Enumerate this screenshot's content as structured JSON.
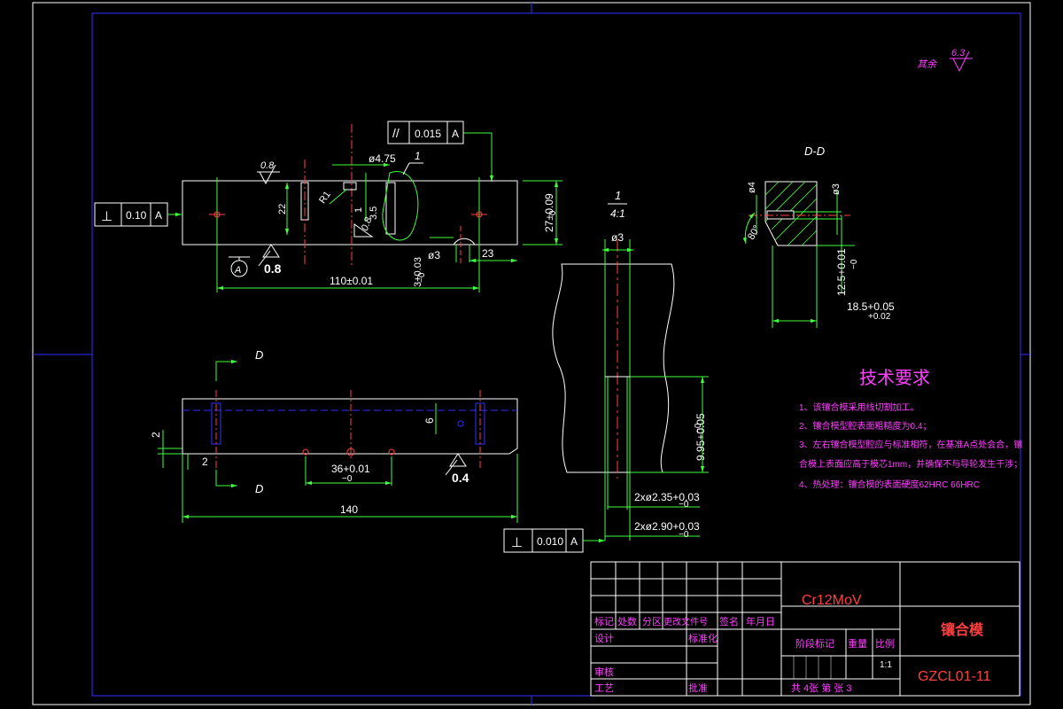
{
  "roughness": {
    "label": "其余",
    "value": "6.3"
  },
  "parallelism": {
    "symbol": "//",
    "value": "0.015",
    "datum": "A"
  },
  "perp_top": {
    "symbol": "⊥",
    "value": "0.10",
    "datum": "A"
  },
  "perp_bottom": {
    "symbol": "⊥",
    "value": "0.010",
    "datum": "A"
  },
  "datum_label": "A",
  "top_view": {
    "rough_08": "0.8",
    "rough_08b": "0.8",
    "rough_08c": "0.8",
    "d475": "ø4.75",
    "callout_1": "1",
    "r1": "R1",
    "dim_22": "22",
    "dim_1": "1",
    "dim_35": "3.5",
    "dim_27": "27+0.09",
    "dim_27b": "−0",
    "d3": "ø3",
    "dim_23": "23",
    "dim_3": "3+0.03",
    "dim_3b": "−0",
    "dim_110": "110±0.01"
  },
  "front_view": {
    "sec_d1": "D",
    "sec_d2": "D",
    "dim_2v": "2",
    "dim_2h": "2",
    "dim_6": "6",
    "dim_36": "36+0.01",
    "dim_36b": "−0",
    "rough_04": "0.4",
    "dim_140": "140"
  },
  "detail": {
    "label": "1",
    "scale": "4:1",
    "d3": "ø3",
    "dim_995": "9.95+0.05",
    "dim_995b": "−0",
    "d235": "2xø2.35+0.03",
    "d235b": "−0",
    "d290": "2xø2.90+0.03",
    "d290b": "−0"
  },
  "section": {
    "title": "D-D",
    "d4": "ø4",
    "d3": "ø3",
    "angle": "80°",
    "dim_125": "12.5+0.01",
    "dim_125b": "−0",
    "dim_185": "18.5+0.05",
    "dim_185b": "+0.02"
  },
  "tech_req": {
    "title": "技术要求",
    "lines": [
      "1、该镶合模采用线切割加工。",
      "2、镶合模型腔表面粗糙度为0.4；",
      "3、左右镶合模型腔应与标准相符，在基准A点处会合，镶",
      "合模上表面应高于模芯1mm，并确保不与导轮发生干涉；",
      "4、热处理：镶合模的表面硬度62HRC  66HRC"
    ]
  },
  "title_block": {
    "material": "Cr12MoV",
    "part_name": "镶合模",
    "drawing_no": "GZCL01-11",
    "h_mark": "标记",
    "h_count": "处数",
    "h_zone": "分区",
    "h_doc": "更改文件号",
    "h_sign": "签名",
    "h_date": "年月日",
    "design": "设计",
    "standard": "标准化",
    "stage": "阶段标记",
    "weight": "重量",
    "ratio_h": "比例",
    "ratio": "1:1",
    "review": "审核",
    "process": "工艺",
    "approve": "批准",
    "sheets": "共  4张  第  张 3"
  }
}
